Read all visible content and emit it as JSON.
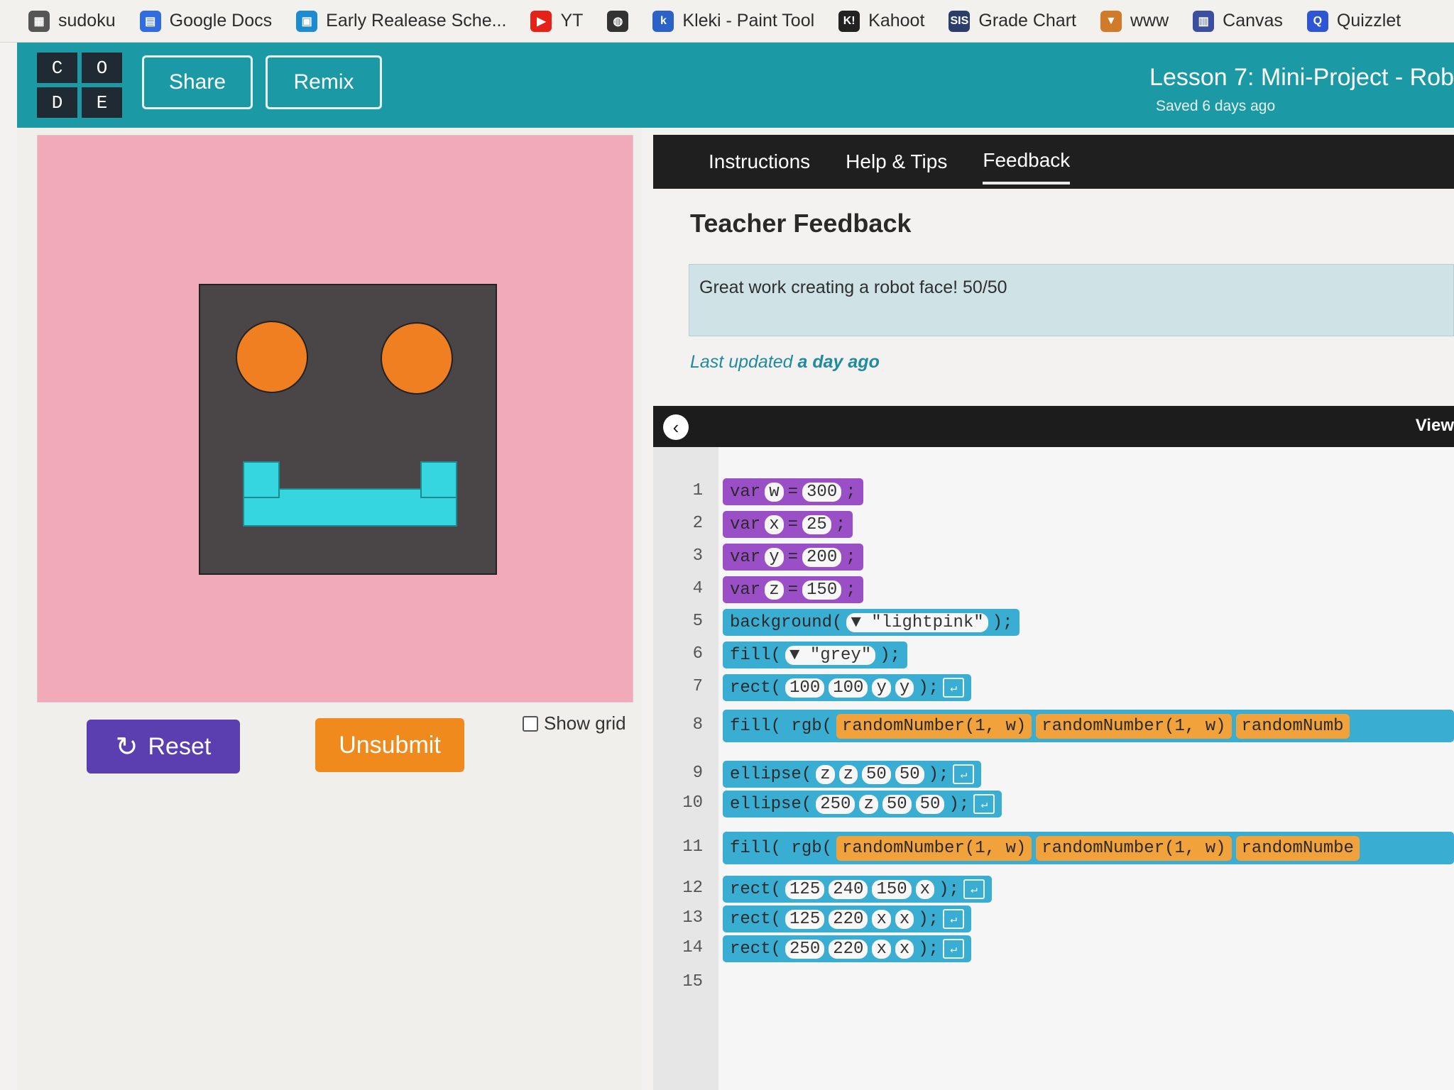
{
  "bookmarks": [
    {
      "label": "sudoku",
      "icon": "grid-icon",
      "color": "#555555"
    },
    {
      "label": "Google Docs",
      "icon": "docs-icon",
      "color": "#2f6de0"
    },
    {
      "label": "Early Realease Sche...",
      "icon": "calendar-icon",
      "color": "#1d8bd1"
    },
    {
      "label": "YT",
      "icon": "youtube-icon",
      "color": "#e62117"
    },
    {
      "label": "",
      "icon": "globe-icon",
      "color": "#333333"
    },
    {
      "label": "Kleki - Paint Tool",
      "icon": "kleki-icon",
      "color": "#2a62c9"
    },
    {
      "label": "Kahoot",
      "icon": "kahoot-icon",
      "color": "#222222"
    },
    {
      "label": "Grade Chart",
      "icon": "sis-icon",
      "color": "#2b3d6b"
    },
    {
      "label": "www",
      "icon": "fox-icon",
      "color": "#d07a2a"
    },
    {
      "label": "Canvas",
      "icon": "canvas-icon",
      "color": "#3b4fa0"
    },
    {
      "label": "Quizzlet",
      "icon": "quizlet-icon",
      "color": "#2d55d6"
    }
  ],
  "header": {
    "logo": [
      "C",
      "O",
      "D",
      "E"
    ],
    "share_label": "Share",
    "remix_label": "Remix",
    "lesson_title": "Lesson 7: Mini-Project - Rob",
    "saved_status": "Saved 6 days ago"
  },
  "controls": {
    "reset_label": "Reset",
    "unsubmit_label": "Unsubmit",
    "show_grid_label": "Show grid"
  },
  "tabs": [
    {
      "label": "Instructions",
      "active": false
    },
    {
      "label": "Help & Tips",
      "active": false
    },
    {
      "label": "Feedback",
      "active": true
    }
  ],
  "feedback": {
    "heading": "Teacher Feedback",
    "message": "Great work creating a robot face! 50/50",
    "last_updated_prefix": "Last updated",
    "last_updated_value": "a day ago"
  },
  "code_panel": {
    "view_label": "View"
  },
  "code_lines": [
    {
      "no": "1",
      "parts": [
        "var",
        "w",
        "=",
        "300",
        ";"
      ]
    },
    {
      "no": "2",
      "parts": [
        "var",
        "x",
        "=",
        "25",
        ";"
      ]
    },
    {
      "no": "3",
      "parts": [
        "var",
        "y",
        "=",
        "200",
        ";"
      ]
    },
    {
      "no": "4",
      "parts": [
        "var",
        "z",
        "=",
        "150",
        ";"
      ]
    },
    {
      "no": "5",
      "text": "background(",
      "arg": "\"lightpink\"",
      "end": ");"
    },
    {
      "no": "6",
      "text": "fill(",
      "arg": "\"grey\"",
      "end": ");"
    },
    {
      "no": "7",
      "text": "rect(",
      "args": [
        "100",
        "100",
        "y",
        "y"
      ],
      "end": ");"
    },
    {
      "no": "8",
      "text": "fill( rgb(",
      "calls": [
        "randomNumber(1, w)",
        "randomNumber(1, w)",
        "randomNumb"
      ]
    },
    {
      "no": "9",
      "text": "ellipse(",
      "args": [
        "z",
        "z",
        "50",
        "50"
      ],
      "end": ");"
    },
    {
      "no": "10",
      "text": "ellipse(",
      "args": [
        "250",
        "z",
        "50",
        "50"
      ],
      "end": ");"
    },
    {
      "no": "11",
      "text": "fill( rgb(",
      "calls": [
        "randomNumber(1, w)",
        "randomNumber(1, w)",
        "randomNumbe"
      ]
    },
    {
      "no": "12",
      "text": "rect(",
      "args": [
        "125",
        "240",
        "150",
        "x"
      ],
      "end": ");"
    },
    {
      "no": "13",
      "text": "rect(",
      "args": [
        "125",
        "220",
        "x",
        "x"
      ],
      "end": ");"
    },
    {
      "no": "14",
      "text": "rect(",
      "args": [
        "250",
        "220",
        "x",
        "x"
      ],
      "end": ");"
    },
    {
      "no": "15"
    }
  ],
  "colors": {
    "header": "#1b9aa6",
    "canvas_background": "#f1aab8",
    "robot_face": "#4a4547",
    "eyes": "#f07f22",
    "mouth": "#36d6e0"
  }
}
